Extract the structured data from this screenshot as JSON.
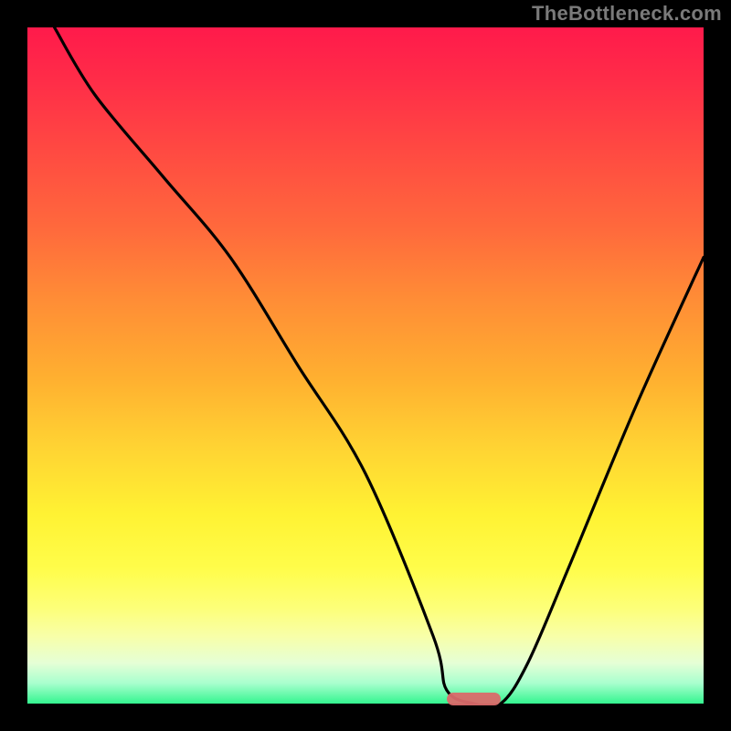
{
  "watermark": "TheBottleneck.com",
  "chart_data": {
    "type": "line",
    "title": "",
    "xlabel": "",
    "ylabel": "",
    "xlim": [
      0,
      100
    ],
    "ylim": [
      0,
      100
    ],
    "series": [
      {
        "name": "curve",
        "x": [
          4,
          10,
          20,
          30,
          40,
          50,
          60,
          62,
          66,
          70,
          74,
          80,
          90,
          100
        ],
        "values": [
          100,
          90,
          78,
          66,
          50,
          34,
          10,
          2,
          0,
          0,
          6,
          20,
          44,
          66
        ]
      }
    ],
    "marker": {
      "x_start": 62,
      "x_end": 70,
      "y": 0
    },
    "gradient_note": "background encodes bottleneck severity red→green"
  }
}
